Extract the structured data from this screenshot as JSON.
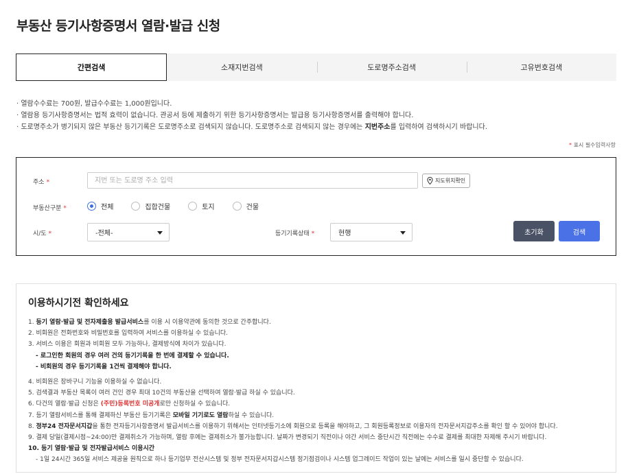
{
  "page_title": "부동산 등기사항증명서 열람·발급 신청",
  "tabs": [
    {
      "label": "간편검색",
      "active": true
    },
    {
      "label": "소재지번검색",
      "active": false
    },
    {
      "label": "도로명주소검색",
      "active": false
    },
    {
      "label": "고유번호검색",
      "active": false
    }
  ],
  "notes": {
    "n1": "열람수수료는 700원, 발급수수료는 1,000원입니다.",
    "n2": "열람용 등기사항증명서는 법적 효력이 없습니다. 관공서 등에 제출하기 위한 등기사항증명서는 발급용 등기사항증명서를 출력해야 합니다.",
    "n3_pre": "도로명주소가 병기되지 않은 부동산 등기기록은 도로명주소로 검색되지 않습니다. 도로명주소로 검색되지 않는 경우에는 ",
    "n3_bold": "지번주소",
    "n3_post": "를 입력하여 검색하시기 바랍니다."
  },
  "required_legend": "표시 필수입력사항",
  "required_star": "*",
  "form": {
    "address_label": "주소",
    "address_placeholder": "지번 또는 도로명 주소 입력",
    "address_value": "",
    "map_button": "지도위치확인",
    "type_label": "부동산구분",
    "type_options": [
      "전체",
      "집합건물",
      "토지",
      "건물"
    ],
    "type_selected": "전체",
    "sido_label": "시/도",
    "sido_value": "-전체-",
    "status_label": "등기기록상태",
    "status_value": "현행",
    "reset_button": "초기화",
    "search_button": "검색"
  },
  "info": {
    "title": "이용하시기전 확인하세요",
    "i1_num": "1.",
    "i1_bold": "등기 열람·발급 및 전자제출용 발급서비스",
    "i1_rest": "를 이용 시 이용약관에 동의한 것으로 간주합니다.",
    "i2": "2. 비회원은 전화번호와 비밀번호를 입력하여 서비스를 이용하실 수 있습니다.",
    "i3": "3. 서비스 이용은 회원과 비회원 모두 가능하나, 결제방식에 차이가 있습니다.",
    "i3_sub1": "- 로그인한 회원의 경우 여러 건의 등기기록을 한 번에 결제할 수 있습니다.",
    "i3_sub2": "- 비회원의 경우 등기기록을 1건씩 결제해야 합니다.",
    "i4": "4. 비회원은 장바구니 기능을 이용하실 수 없습니다.",
    "i5": "5. 검색결과 부동산 목록이 여러 건인 경우 최대 10건의 부동산을 선택하여 열람·발급 하실 수 있습니다.",
    "i6_pre": "6. 다건의 열람·발급 신청은 ",
    "i6_red": "(주민)등록번호 미공개",
    "i6_post": "로만 신청하실 수 있습니다.",
    "i7_pre": "7. 등기 열람서비스를 통해 결제하신 부동산 등기기록은 ",
    "i7_bold": "모바일 기기로도 열람",
    "i7_post": "하실 수 있습니다.",
    "i8_num": "8.",
    "i8_bold": "정부24 전자문서지갑",
    "i8_rest": "을 통한 전자등기사항증명서 발급서비스를 이용하기 위해서는 인터넷등기소에 회원으로 등록을 해야하고, 그 회원등록정보로 이용자의 전자문서지갑주소를 확인 할 수 있어야 합니다.",
    "i9": "9. 결제 당일(결제시점~24:00)만 결제취소가 가능하며, 열람 후에는 결제취소가 불가능합니다. 날짜가 변경되기 직전이나 야간 서비스 중단시간 직전에는 수수료 결제를 최대한 자제해 주시기 바랍니다.",
    "i10": "10. 등기 열람·발급 및 전자발급서비스 이용시간",
    "i10_sub": "- 1일 24시간 365일 서비스 제공을 원칙으로 하나 등기업무 전산시스템 및 정부 전자문서지갑시스템 정기점검이나 시스템 업그레이드 작업이 있는 날에는 서비스를 일시 중단할 수 있습니다."
  }
}
